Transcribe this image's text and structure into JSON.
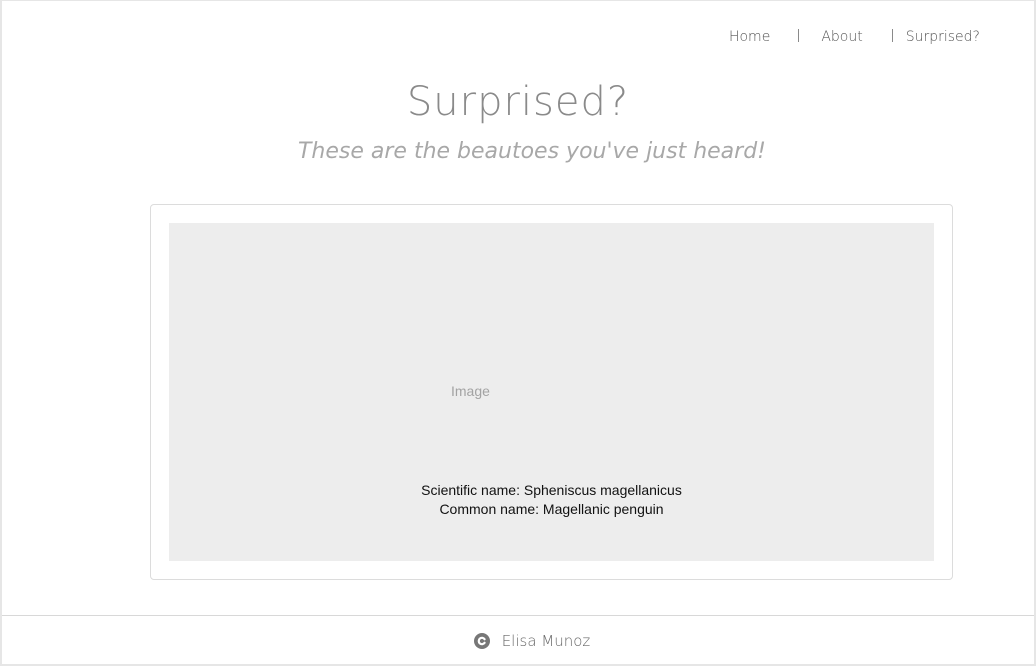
{
  "nav": {
    "items": [
      {
        "label": "Home"
      },
      {
        "label": "About"
      },
      {
        "label": "Surprised?"
      }
    ]
  },
  "header": {
    "title": "Surprised?",
    "subtitle": "These are the beautoes you've just heard!"
  },
  "card": {
    "image_alt": "Image",
    "scientific_name": "Scientific name: Spheniscus magellanicus",
    "common_name": "Common name: Magellanic penguin"
  },
  "footer": {
    "icon": "copyright-icon",
    "author": "Elisa Munoz"
  }
}
